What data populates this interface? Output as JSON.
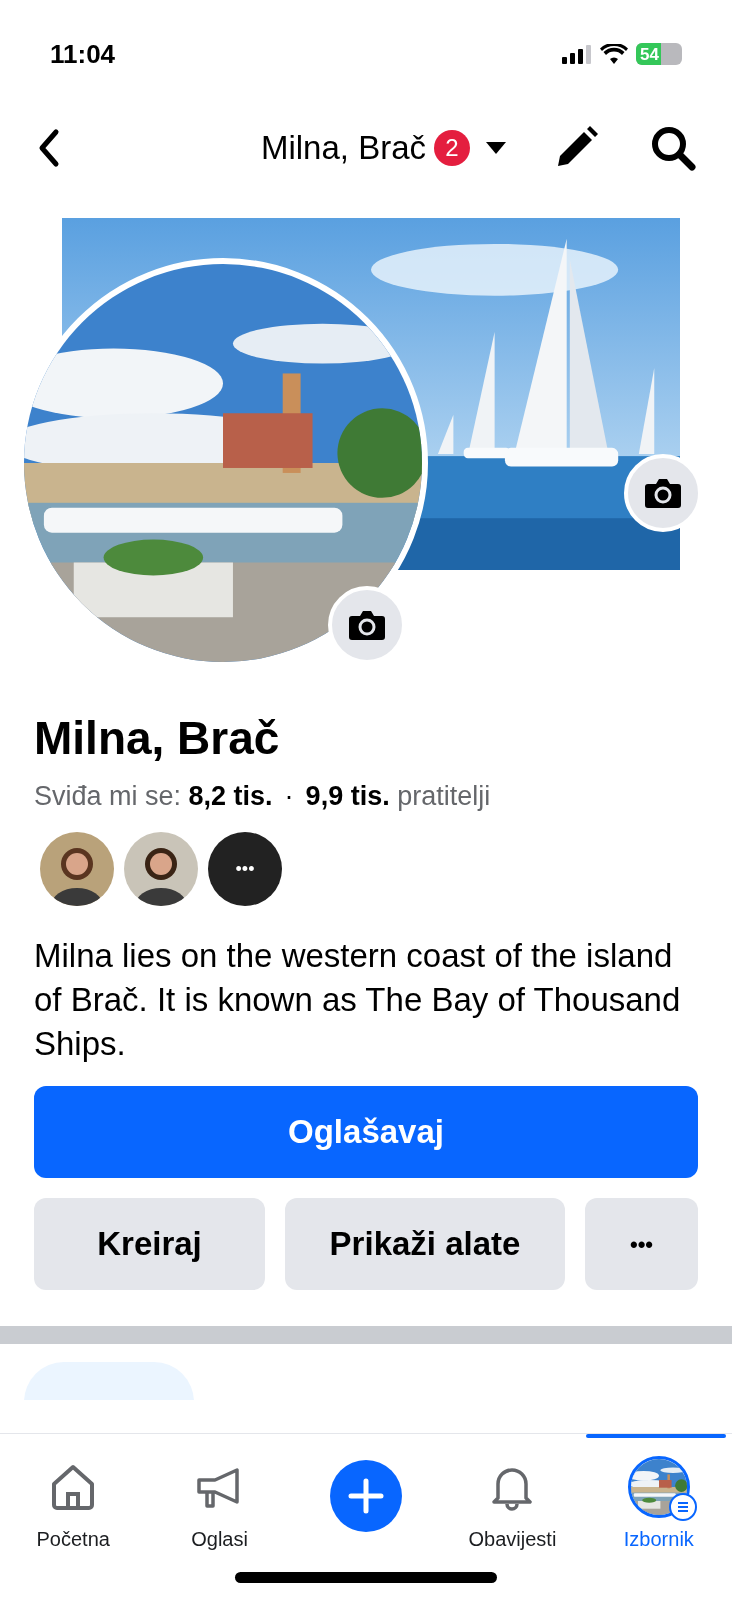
{
  "status_bar": {
    "time": "11:04",
    "battery": "54"
  },
  "header": {
    "title": "Milna, Brač",
    "badge": "2"
  },
  "page": {
    "name": "Milna, Brač",
    "likes": "Sviđa mi se: **8,2 tis.**",
    "separator": "·",
    "followers": "**9,9 tis.** pratitelji",
    "more_friends": "•••",
    "description": "Milna lies on the western coast of the island of Brač. It is known as The Bay of Thousand Ships."
  },
  "actions": {
    "primary": "Oglašavaj",
    "secondary": [
      "Kreiraj",
      "Prikaži alate"
    ],
    "more": "•••"
  },
  "bottom_nav": [
    {
      "kind": "tab",
      "label": "Početna",
      "selected": false
    },
    {
      "kind": "tab",
      "label": "Oglasi",
      "selected": false
    },
    {
      "kind": "create",
      "selected": false
    },
    {
      "kind": "tab",
      "label": "Obavijesti",
      "selected": false
    },
    {
      "kind": "tab",
      "label": "Izbornik",
      "selected": true
    }
  ]
}
